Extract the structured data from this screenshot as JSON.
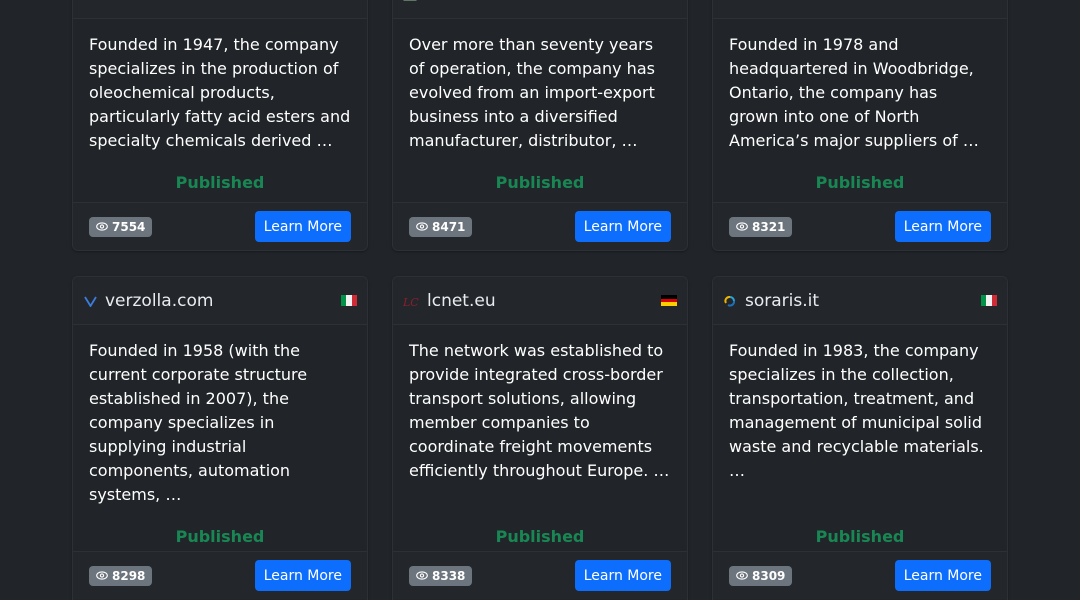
{
  "status_label": "Published",
  "button_label": "Learn More",
  "cards_top": [
    {
      "description": "Founded in 1947, the company specializes in the production of oleochemical products, particularly fatty acid esters and specialty chemicals derived …",
      "views": "7554"
    },
    {
      "description": "Over more than seventy years of operation, the company has evolved from an import-export business into a diversified manufacturer, distributor, …",
      "views": "8471"
    },
    {
      "description": "Founded in 1978 and headquartered in Woodbridge, Ontario, the company has grown into one of North America’s major suppliers of …",
      "views": "8321"
    }
  ],
  "cards_bottom": [
    {
      "site": "verzolla.com",
      "flag": "it",
      "description": "Founded in 1958 (with the current corporate structure established in 2007), the company specializes in supplying industrial components, automation systems, …",
      "views": "8298"
    },
    {
      "site": "lcnet.eu",
      "flag": "de",
      "description": "The network was established to provide integrated cross-border transport solutions, allowing member companies to coordinate freight movements efficiently throughout Europe. …",
      "views": "8338"
    },
    {
      "site": "soraris.it",
      "flag": "it",
      "description": "Founded in 1983, the company specializes in the collection, transportation, treatment, and management of municipal solid waste and recyclable materials. …",
      "views": "8309"
    }
  ],
  "colors": {
    "published": "#198754",
    "button": "#0d6efd",
    "badge": "#6c757d"
  },
  "icons": [
    "eye-icon",
    "verzolla-logo-icon",
    "lcnet-logo-icon",
    "soraris-logo-icon",
    "italy-flag-icon",
    "germany-flag-icon"
  ]
}
